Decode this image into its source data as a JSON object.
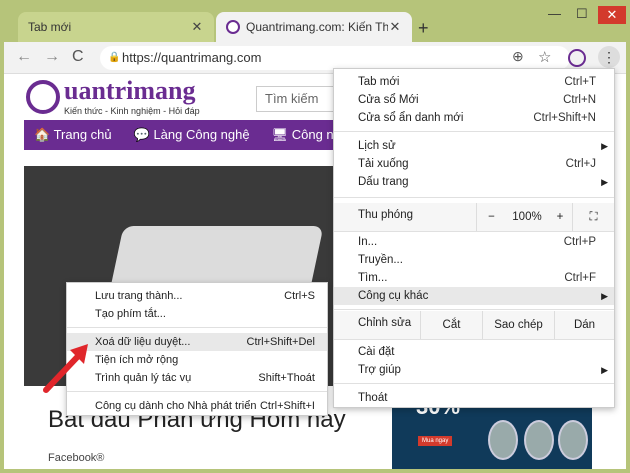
{
  "tabs": [
    {
      "title": "Tab mới",
      "close": "✕"
    },
    {
      "title": "Quantrimang.com: Kiến Thức Cô",
      "close": "✕"
    }
  ],
  "newtab": "+",
  "window": {
    "min": "—",
    "max": "☐",
    "close": "✕"
  },
  "toolbar": {
    "back": "←",
    "forward": "→",
    "reload": "C",
    "url": "https://quantrimang.com"
  },
  "page": {
    "logo": "uantrimang",
    "tagline": "Kiến thức - Kinh nghiệm - Hỏi đáp",
    "search_placeholder": "Tìm kiếm",
    "nav": [
      "Trang chủ",
      "Làng Công nghệ",
      "Công nghệ"
    ],
    "article_title": "Bắt đầu Phản ứng Hôm nay",
    "facebook": "Facebook®",
    "ad_pct": "30%",
    "ad_btn": "Mua ngay"
  },
  "menu": {
    "items": [
      {
        "label": "Tab mới",
        "shortcut": "Ctrl+T"
      },
      {
        "label": "Cửa sổ Mới",
        "shortcut": "Ctrl+N"
      },
      {
        "label": "Cửa sổ ẩn danh mới",
        "shortcut": "Ctrl+Shift+N"
      },
      {
        "label": "Lịch sử",
        "shortcut": "▶"
      },
      {
        "label": "Tải xuống",
        "shortcut": "Ctrl+J"
      },
      {
        "label": "Dấu trang",
        "shortcut": "▶"
      },
      {
        "label": "In...",
        "shortcut": "Ctrl+P"
      },
      {
        "label": "Truyền...",
        "shortcut": ""
      },
      {
        "label": "Tìm...",
        "shortcut": "Ctrl+F"
      },
      {
        "label": "Công cụ khác",
        "shortcut": "▶"
      },
      {
        "label": "Cài đặt",
        "shortcut": ""
      },
      {
        "label": "Trợ giúp",
        "shortcut": "▶"
      },
      {
        "label": "Thoát",
        "shortcut": ""
      }
    ],
    "zoom": {
      "label": "Thu phóng",
      "minus": "−",
      "value": "100%",
      "plus": "+",
      "full": "⛶"
    },
    "edit": {
      "label": "Chỉnh sửa",
      "cut": "Cắt",
      "copy": "Sao chép",
      "paste": "Dán"
    }
  },
  "submenu": {
    "items": [
      {
        "label": "Lưu trang thành...",
        "shortcut": "Ctrl+S"
      },
      {
        "label": "Tạo phím tắt...",
        "shortcut": ""
      },
      {
        "label": "Xoá dữ liệu duyệt...",
        "shortcut": "Ctrl+Shift+Del"
      },
      {
        "label": "Tiện ích mở rộng",
        "shortcut": ""
      },
      {
        "label": "Trình quản lý tác vụ",
        "shortcut": "Shift+Thoát"
      },
      {
        "label": "Công cụ dành cho Nhà phát triển",
        "shortcut": "Ctrl+Shift+I"
      }
    ]
  },
  "colors": {
    "brand": "#6a2c91",
    "titlebar": "#b6c47a",
    "arrow": "#e0262b"
  }
}
